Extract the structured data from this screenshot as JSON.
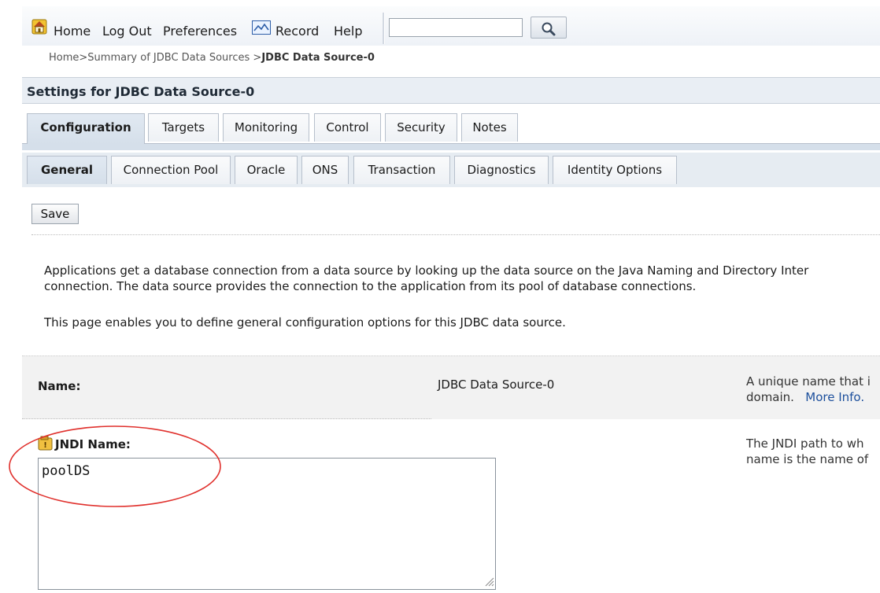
{
  "toolbar": {
    "home_label": "Home",
    "logout_label": "Log Out",
    "preferences_label": "Preferences",
    "record_label": "Record",
    "help_label": "Help",
    "search_value": "",
    "home_icon": "home-icon",
    "record_icon": "record-icon",
    "search_icon": "magnifier-icon"
  },
  "breadcrumb": {
    "items": [
      "Home",
      "Summary of JDBC Data Sources"
    ],
    "current": "JDBC Data Source-0",
    "separator": ">"
  },
  "settings": {
    "title": "Settings for JDBC Data Source-0"
  },
  "tabs": {
    "primary": [
      "Configuration",
      "Targets",
      "Monitoring",
      "Control",
      "Security",
      "Notes"
    ],
    "primary_active": "Configuration",
    "secondary": [
      "General",
      "Connection Pool",
      "Oracle",
      "ONS",
      "Transaction",
      "Diagnostics",
      "Identity Options"
    ],
    "secondary_active": "General"
  },
  "save_label": "Save",
  "description": {
    "line1": "Applications get a database connection from a data source by looking up the data source on the Java Naming and Directory Inter",
    "line2": "connection. The data source provides the connection to the application from its pool of database connections.",
    "line3": "This page enables you to define general configuration options for this JDBC data source."
  },
  "fields": {
    "name": {
      "label": "Name:",
      "value": "JDBC Data Source-0",
      "help_line1": "A unique name that i",
      "help_line2": "domain.",
      "more_info": "More Info."
    },
    "jndi": {
      "label": "JNDI Name:",
      "value": "poolDS",
      "help_line1": "The JNDI path to wh",
      "help_line2": "name is the name of",
      "icon": "warning-icon"
    }
  },
  "colors": {
    "header_bg": "#e9eef4",
    "tab_active_bg": "#d5dfea",
    "link": "#1c4f9c",
    "highlight_circle": "#e0302c"
  }
}
